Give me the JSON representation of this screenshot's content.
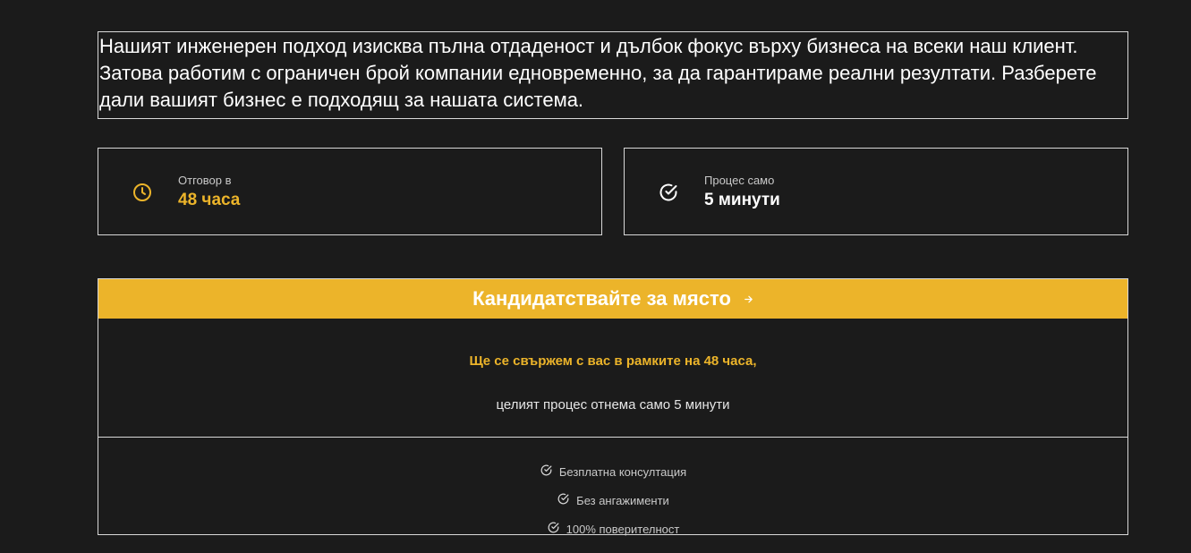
{
  "intro": {
    "text": "Нашият инженерен подход изисква пълна отдаденост и дълбок фокус върху бизнеса на всеки наш клиент. Затова работим с ограничен брой компании едновременно, за да гарантираме реални резултати. Разберете дали вашият бизнес е подходящ за нашата система."
  },
  "cards": [
    {
      "icon": "clock-icon",
      "label": "Отговор в",
      "value": "48 часа",
      "color": "#ecb42a"
    },
    {
      "icon": "check-circle-icon",
      "label": "Процес само",
      "value": "5 минути",
      "color": "#ffffff"
    }
  ],
  "cta": {
    "button_label": "Кандидатствайте за място",
    "arrow_icon": "arrow-right-icon",
    "promise": "Ще се свържем с вас в рамките на 48 часа,",
    "subline": "целият процес отнема само 5 минути",
    "benefits": [
      "Безплатна консултация",
      "Без ангажименти",
      "100% поверителност"
    ]
  },
  "colors": {
    "background": "#1b1b1b",
    "accent": "#ecb42a",
    "border": "#d8d8d8",
    "text": "#ffffff",
    "muted": "#c9c9c9"
  }
}
